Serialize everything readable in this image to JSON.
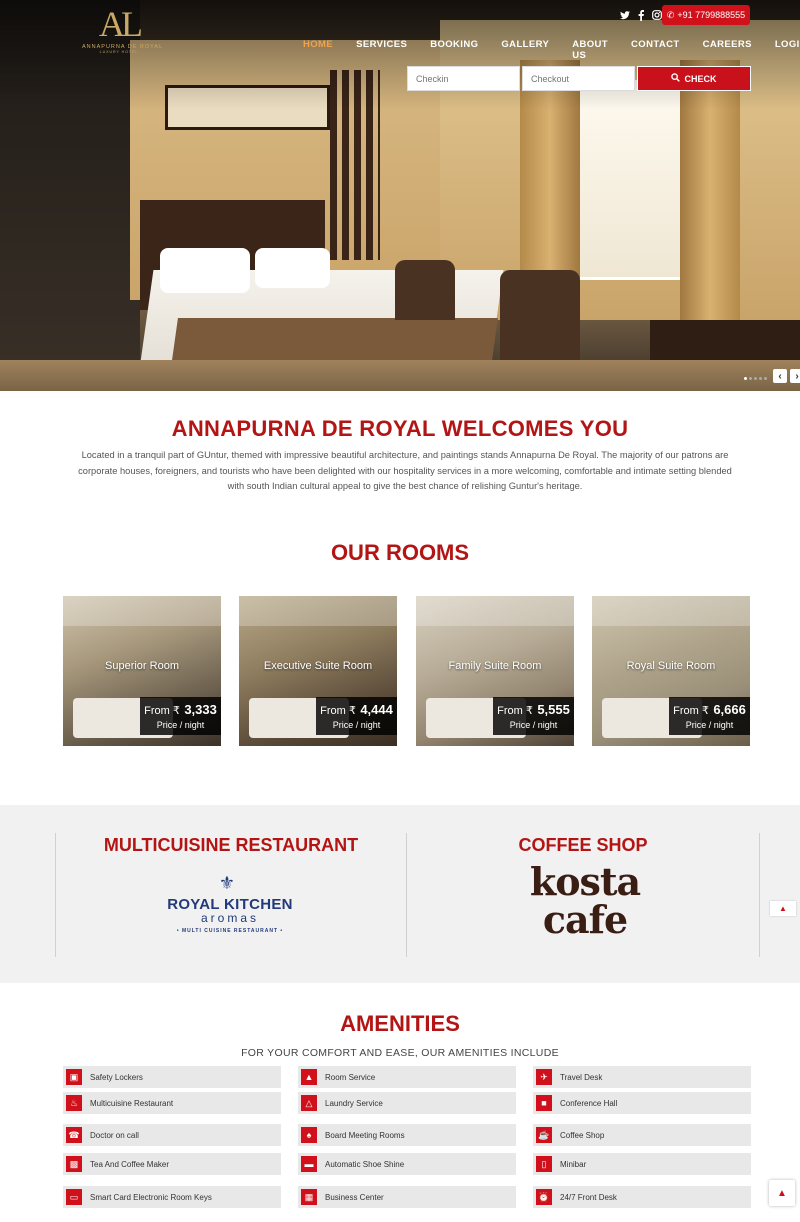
{
  "header": {
    "logo_mark": "AL",
    "logo_name": "ANNAPURNA DE ROYAL",
    "logo_sub": "LUXURY HOTEL",
    "phone": "+91 7799888555",
    "nav": [
      "HOME",
      "SERVICES",
      "BOOKING",
      "GALLERY",
      "ABOUT US",
      "CONTACT",
      "CAREERS",
      "LOGIN"
    ],
    "active_nav": "HOME",
    "checkin_placeholder": "Checkin",
    "checkout_placeholder": "Checkout",
    "check_label": "CHECK"
  },
  "welcome": {
    "title": "ANNAPURNA DE ROYAL WELCOMES YOU",
    "text": "Located in a tranquil part of GUntur, themed with impressive beautiful architecture, and paintings stands Annapurna De Royal. The majority of our patrons are corporate houses, foreigners, and tourists who have been delighted with our hospitality services in a more welcoming, comfortable and intimate setting blended with south Indian cultural appeal to give the best chance of relishing Guntur's heritage."
  },
  "rooms": {
    "title": "OUR ROOMS",
    "items": [
      {
        "name": "Superior Room",
        "from": "From ₹",
        "amount": "3,333",
        "per": "Price / night"
      },
      {
        "name": "Executive Suite Room",
        "from": "From ₹",
        "amount": "4,444",
        "per": "Price / night"
      },
      {
        "name": "Family Suite Room",
        "from": "From ₹",
        "amount": "5,555",
        "per": "Price / night"
      },
      {
        "name": "Royal Suite Room",
        "from": "From ₹",
        "amount": "6,666",
        "per": "Price / night"
      }
    ]
  },
  "dining": {
    "restaurant_title": "MULTICUISINE RESTAURANT",
    "restaurant_logo_brand": "ROYAL KITCHEN",
    "restaurant_logo_aromas": "aromas",
    "restaurant_logo_tag": "• MULTI CUISINE RESTAURANT •",
    "coffee_title": "COFFEE SHOP",
    "coffee_logo_line1": "kosta",
    "coffee_logo_line2": "cafe"
  },
  "amenities": {
    "title": "AMENITIES",
    "subtitle": "FOR YOUR COMFORT AND EASE, OUR AMENITIES INCLUDE",
    "items": [
      "Safety Lockers",
      "Room Service",
      "Travel Desk",
      "Multicuisine Restaurant",
      "Laundry Service",
      "Conference Hall",
      "Doctor on call",
      "Board Meeting Rooms",
      "Coffee Shop",
      "Tea And Coffee Maker",
      "Automatic Shoe Shine",
      "Minibar",
      "Smart Card Electronic Room Keys",
      "Business Center",
      "24/7 Front Desk"
    ]
  },
  "colors": {
    "accent": "#b31515",
    "button": "#c8111b",
    "nav_active": "#f0a34b"
  }
}
